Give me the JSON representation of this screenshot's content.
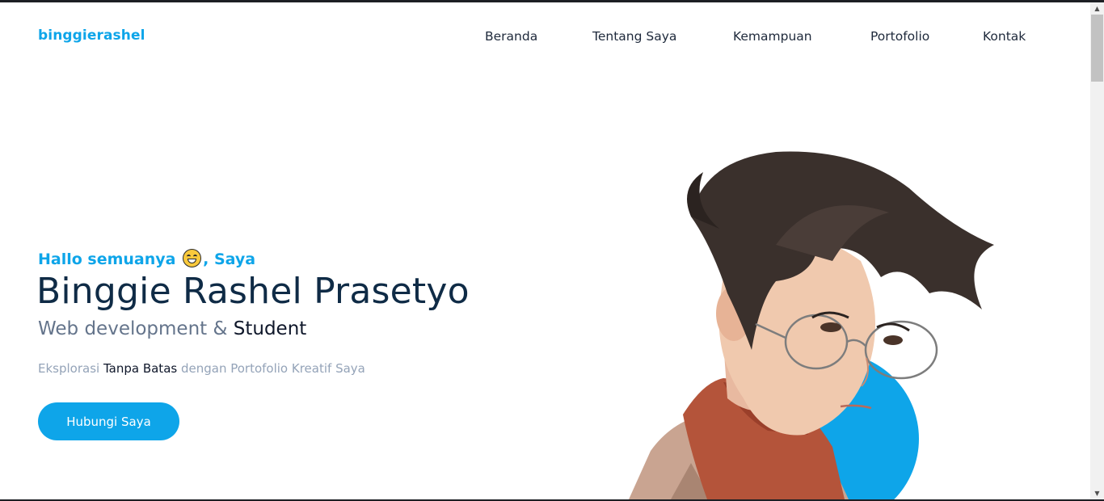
{
  "header": {
    "brand": "binggierashel",
    "nav": [
      "Beranda",
      "Tentang Saya",
      "Kemampuan",
      "Portofolio",
      "Kontak"
    ]
  },
  "hero": {
    "greeting_before": "Hallo semuanya",
    "greeting_after": ", Saya",
    "emoji": "grinning-face-icon",
    "name": "Binggie Rashel Prasetyo",
    "role_light": "Web development &",
    "role_dark": "Student",
    "tagline_start": "Eksplorasi",
    "tagline_mid": "Tanpa Batas",
    "tagline_end": "dengan Portofolio Kreatif Saya",
    "cta_label": "Hubungi Saya"
  },
  "colors": {
    "accent": "#0ea5e9",
    "heading": "#0f2b46",
    "muted": "#94a3b8"
  }
}
